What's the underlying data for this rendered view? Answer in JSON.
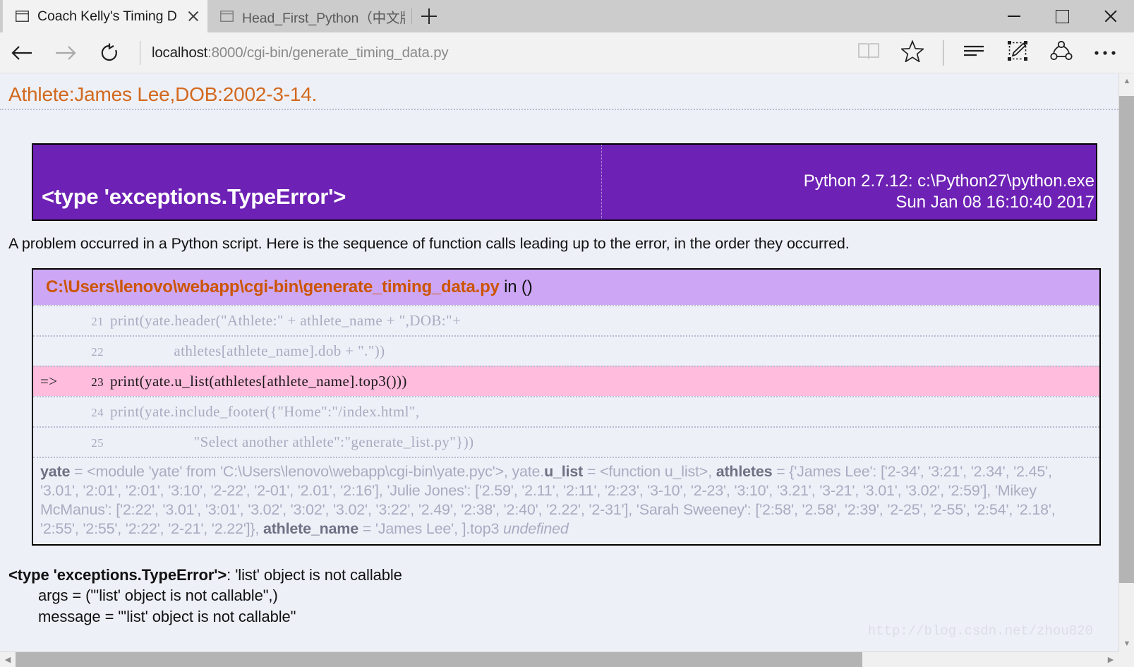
{
  "window": {
    "controls": {
      "minimize": "minimize",
      "maximize": "maximize",
      "close": "close"
    }
  },
  "tabs": [
    {
      "title": "Coach Kelly's Timing Da",
      "active": true,
      "icon": "page-icon"
    },
    {
      "title": "Head_First_Python（中文版",
      "active": false,
      "icon": "page-icon"
    }
  ],
  "newtab_label": "+",
  "toolbar": {
    "back": "Back",
    "forward": "Forward",
    "refresh": "Refresh",
    "address_host": "localhost",
    "address_path": ":8000/cgi-bin/generate_timing_data.py",
    "address_full": "localhost:8000/cgi-bin/generate_timing_data.py",
    "reading_view": "reading-view",
    "favorites": "add-to-favorites",
    "hub": "hub",
    "web_note": "make-a-web-note",
    "share": "share",
    "more": "more-settings"
  },
  "page": {
    "athlete_header": "Athlete:James Lee,DOB:2002-3-14.",
    "exception_banner": {
      "type": "<type 'exceptions.TypeError'>",
      "python_version": "Python 2.7.12: c:\\Python27\\python.exe",
      "timestamp": "Sun Jan 08 16:10:40 2017"
    },
    "intro": "A problem occurred in a Python script. Here is the sequence of function calls leading up to the error, in the order they occurred.",
    "frame": {
      "file": "C:\\Users\\lenovo\\webapp\\cgi-bin\\generate_timing_data.py",
      "in_label": "in ()",
      "lines": [
        {
          "arrow": "",
          "number": "21",
          "code": "print(yate.header(\"Athlete:\" + athlete_name + \",DOB:\"+",
          "current": false
        },
        {
          "arrow": "",
          "number": "22",
          "code": "                athletes[athlete_name].dob + \".\"))",
          "current": false
        },
        {
          "arrow": "=>",
          "number": "23",
          "code": "print(yate.u_list(athletes[athlete_name].top3()))",
          "current": true
        },
        {
          "arrow": "",
          "number": "24",
          "code": "print(yate.include_footer({\"Home\":\"/index.html\",",
          "current": false
        },
        {
          "arrow": "",
          "number": "25",
          "code": "                     \"Select another athlete\":\"generate_list.py\"}))",
          "current": false
        }
      ],
      "vars_html": "<b>yate</b> = &lt;module 'yate' from 'C:\\Users\\lenovo\\webapp\\cgi-bin\\yate.pyc'&gt;, yate.<b>u_list</b> = &lt;function u_list&gt;, <b>athletes</b> = {'James Lee': ['2-34', '3:21', '2.34', '2.45', '3.01', '2:01', '2:01', '3:10', '2-22', '2-01', '2.01', '2:16'], 'Julie Jones': ['2.59', '2.11', '2:11', '2:23', '3-10', '2-23', '3:10', '3.21', '3-21', '3.01', '3.02', '2:59'], 'Mikey McManus': ['2:22', '3.01', '3:01', '3.02', '3:02', '3.02', '3:22', '2.49', '2:38', '2:40', '2.22', '2-31'], 'Sarah Sweeney': ['2:58', '2.58', '2:39', '2-25', '2-55', '2:54', '2.18', '2:55', '2:55', '2:22', '2-21', '2.22']}, <b>athlete_name</b> = 'James Lee', ].top3 <i>undefined</i>"
    },
    "final_error": {
      "type": "<type 'exceptions.TypeError'>",
      "message_suffix": ": 'list' object is not callable",
      "args_line": "args = (\"'list' object is not callable\",)",
      "message_line": "message = \"'list' object is not callable\""
    },
    "watermark": "http://blog.csdn.net/zhou820"
  },
  "colors": {
    "banner_purple": "#6e21b5",
    "frame_head_lavender": "#cda7f5",
    "current_line_pink": "#ffbcdd",
    "accent_orange": "#cc5500",
    "header_orange": "#d2691e",
    "page_bg": "#eef0f8"
  }
}
